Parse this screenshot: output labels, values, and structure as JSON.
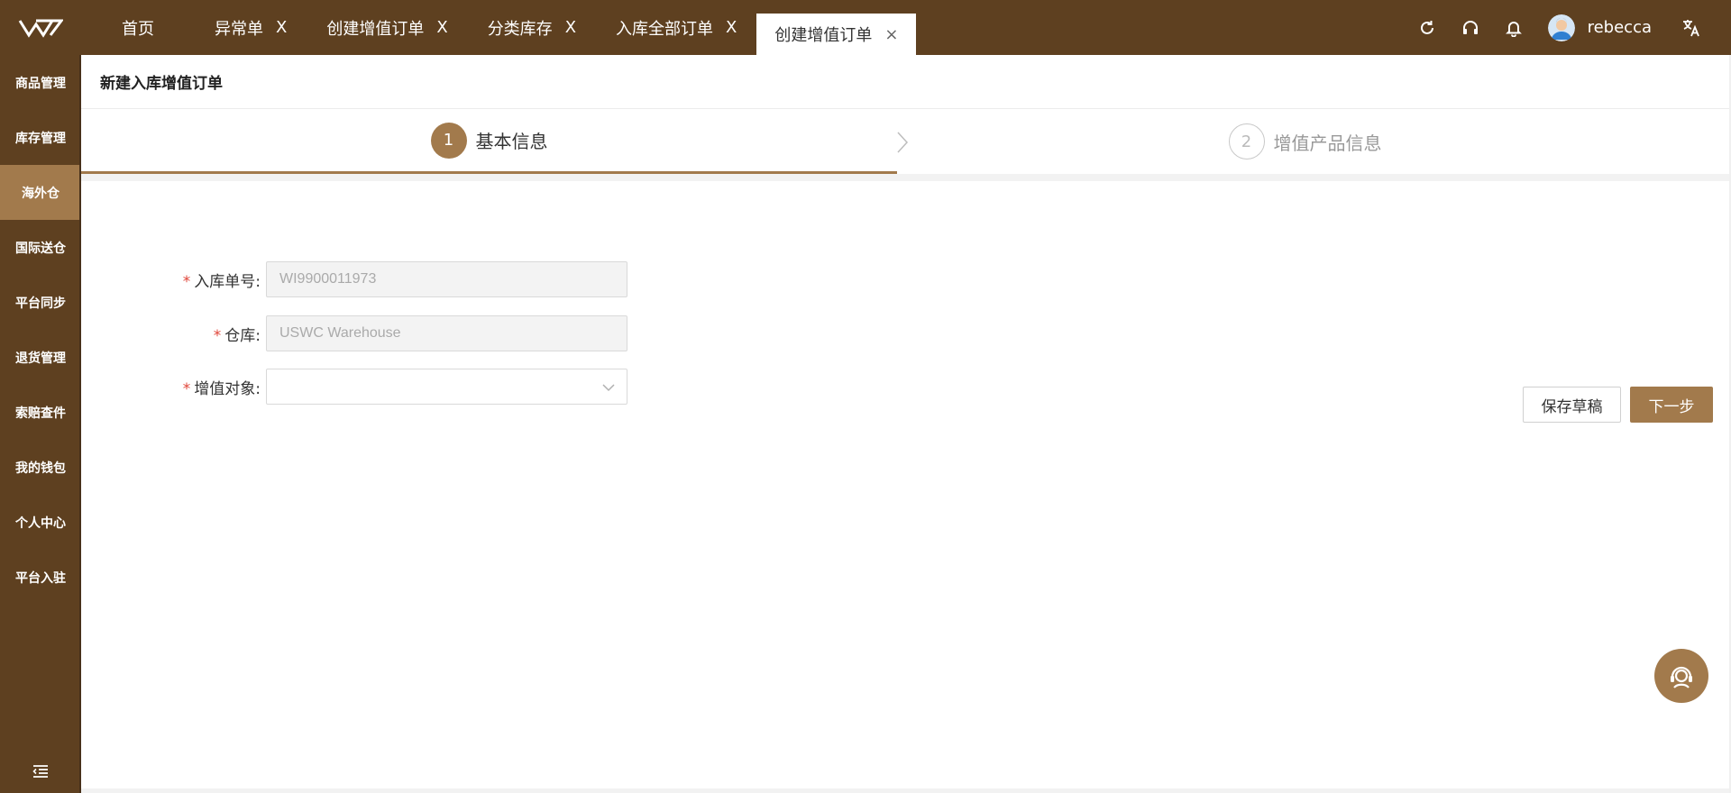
{
  "header": {
    "tabs": [
      {
        "label": "首页",
        "closable": false,
        "active": false
      },
      {
        "label": "异常单",
        "closable": true,
        "active": false
      },
      {
        "label": "创建增值订单",
        "closable": true,
        "active": false
      },
      {
        "label": "分类库存",
        "closable": true,
        "active": false
      },
      {
        "label": "入库全部订单",
        "closable": true,
        "active": false
      },
      {
        "label": "创建增值订单",
        "closable": true,
        "active": true
      }
    ],
    "close_glyph": "X",
    "active_close_glyph": "×",
    "username": "rebecca",
    "icons": [
      "refresh-icon",
      "headset-icon",
      "bell-icon",
      "translate-icon"
    ]
  },
  "sidebar": {
    "items": [
      {
        "label": "商品管理",
        "active": false
      },
      {
        "label": "库存管理",
        "active": false
      },
      {
        "label": "海外仓",
        "active": true
      },
      {
        "label": "国际送仓",
        "active": false
      },
      {
        "label": "平台同步",
        "active": false
      },
      {
        "label": "退货管理",
        "active": false
      },
      {
        "label": "索赔查件",
        "active": false
      },
      {
        "label": "我的钱包",
        "active": false
      },
      {
        "label": "个人中心",
        "active": false
      },
      {
        "label": "平台入驻",
        "active": false
      }
    ]
  },
  "page": {
    "title": "新建入库增值订单",
    "steps": [
      {
        "number": "1",
        "label": "基本信息",
        "active": true
      },
      {
        "number": "2",
        "label": "增值产品信息",
        "active": false
      }
    ],
    "form": {
      "required_mark": "*",
      "order_no": {
        "label": "入库单号:",
        "value": "WI9900011973"
      },
      "warehouse": {
        "label": "仓库:",
        "value": "USWC Warehouse"
      },
      "target": {
        "label": "增值对象:",
        "value": ""
      }
    },
    "buttons": {
      "save_draft": "保存草稿",
      "next": "下一步"
    }
  },
  "colors": {
    "brand_dark": "#5e4020",
    "brand_accent": "#a27a4c",
    "required": "#e0463a"
  }
}
